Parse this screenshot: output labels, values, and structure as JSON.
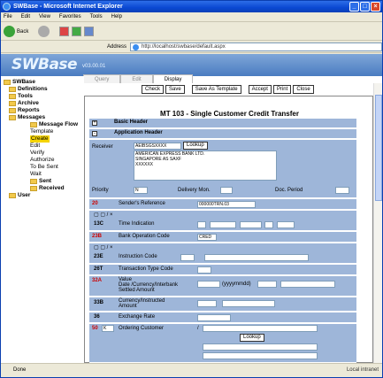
{
  "window": {
    "title": "SWBase - Microsoft Internet Explorer"
  },
  "menu": [
    "File",
    "Edit",
    "View",
    "Favorites",
    "Tools",
    "Help"
  ],
  "toolbar": {
    "back": "Back"
  },
  "address": {
    "label": "Address",
    "url": "http://localhost/swbase/default.aspx"
  },
  "app": {
    "logo": "SWBase",
    "version": "v03.00.01"
  },
  "tabs": [
    "Query",
    "Edit",
    "Display"
  ],
  "tree": [
    {
      "label": "SWBase",
      "level": 0,
      "bold": true
    },
    {
      "label": "Definitions",
      "level": 1,
      "bold": true
    },
    {
      "label": "Tools",
      "level": 1,
      "bold": true
    },
    {
      "label": "Archive",
      "level": 1,
      "bold": true
    },
    {
      "label": "Reports",
      "level": 1,
      "bold": true
    },
    {
      "label": "Messages",
      "level": 1,
      "bold": true
    },
    {
      "label": "Message Flow",
      "level": 2,
      "bold": true
    },
    {
      "label": "Template",
      "level": 3
    },
    {
      "label": "Create",
      "level": 3,
      "selected": true
    },
    {
      "label": "Edit",
      "level": 3
    },
    {
      "label": "Verify",
      "level": 3
    },
    {
      "label": "Authorize",
      "level": 3
    },
    {
      "label": "To Be Sent",
      "level": 3
    },
    {
      "label": "Wait",
      "level": 3
    },
    {
      "label": "Sent",
      "level": 2,
      "bold": true
    },
    {
      "label": "Received",
      "level": 2,
      "bold": true
    },
    {
      "label": "User",
      "level": 1,
      "bold": true
    }
  ],
  "buttons": [
    "Check",
    "Save",
    "Save As Template",
    "Accept",
    "Print",
    "Close"
  ],
  "form": {
    "title": "MT 103 - Single Customer Credit Transfer",
    "basic_header": "Basic Header",
    "app_header": "Application Header",
    "receiver_label": "Receiver",
    "receiver_bic": "AEIBSGSXXXX",
    "lookup": "Lookup",
    "receiver_lines": [
      "AMERICAN EXPRESS BANK LTD.",
      "",
      "SINGAPORE AS SAXF",
      "XXXXXX"
    ],
    "priority_label": "Priority",
    "priority_value": "N",
    "delivery_label": "Delivery Mon.",
    "doc_period_label": "Doc. Period",
    "f20_code": "20",
    "f20_label": "Sender's Reference",
    "f20_value": "000000TRN.03",
    "f13c_code": "13C",
    "f13c_label": "Time Indication",
    "f23b_code": "23B",
    "f23b_label": "Bank Operation Code",
    "f23b_value": "CRED",
    "f23e_code": "23E",
    "f23e_label": "Instruction Code",
    "f26t_code": "26T",
    "f26t_label": "Transaction Type Code",
    "f32a_code": "32A",
    "f32a_lines": [
      "Value",
      "Date /Currency/Interbank",
      "Settled Amount"
    ],
    "yyyymmdd": "(yyyymmdd)",
    "f33b_code": "33B",
    "f33b_lines": [
      "Currency/Instructed",
      "Amount"
    ],
    "f36_code": "36",
    "f36_label": "Exchange Rate",
    "f50_code": "50",
    "f50_label": "Ordering Customer",
    "f50_opt": "K",
    "lookup2": "Lookup"
  },
  "status": {
    "text": "Done",
    "zone": "Local intranet"
  }
}
